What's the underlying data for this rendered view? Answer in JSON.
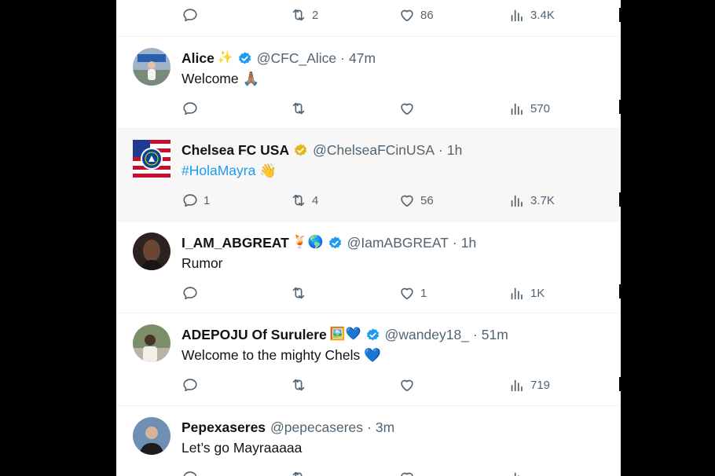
{
  "tweets": [
    {
      "name": "",
      "handle": "",
      "time": "",
      "text": "",
      "stats": {
        "replies": "",
        "retweets": "2",
        "likes": "86",
        "views": "3.4K"
      }
    },
    {
      "name": "Alice",
      "name_emoji": "✨",
      "handle": "@CFC_Alice",
      "sep": "·",
      "time": "47m",
      "text": "Welcome 🙏🏽",
      "stats": {
        "replies": "",
        "retweets": "",
        "likes": "",
        "views": "570"
      }
    },
    {
      "name": "Chelsea FC USA",
      "handle": "@ChelseaFCinUSA",
      "sep": "·",
      "time": "1h",
      "text": "#HolaMayra",
      "text_emoji": "👋",
      "stats": {
        "replies": "1",
        "retweets": "4",
        "likes": "56",
        "views": "3.7K"
      }
    },
    {
      "name": "I_AM_ABGREAT",
      "name_emoji": "🍹🌎",
      "handle": "@IamABGREAT",
      "sep": "·",
      "time": "1h",
      "text": "Rumor",
      "stats": {
        "replies": "",
        "retweets": "",
        "likes": "1",
        "views": "1K"
      }
    },
    {
      "name": "ADEPOJU Of Surulere",
      "name_emoji": "🖼️💙",
      "handle": "@wandey18_",
      "sep": "·",
      "time": "51m",
      "text": "Welcome to the mighty Chels 💙",
      "stats": {
        "replies": "",
        "retweets": "",
        "likes": "",
        "views": "719"
      }
    },
    {
      "name": "Pepexaseres",
      "handle": "@pepecaseres",
      "sep": "·",
      "time": "3m",
      "text": "Let’s go Mayraaaaa",
      "stats": {
        "replies": "",
        "retweets": "",
        "likes": "",
        "views": ""
      }
    }
  ],
  "icons": [
    "reply-icon",
    "retweet-icon",
    "like-icon",
    "views-icon",
    "verified-badge-icon"
  ],
  "colors": {
    "muted": "#536471",
    "link": "#1d9bf0",
    "verified_blue": "#1d9bf0",
    "verified_gold": "#e2b719"
  }
}
